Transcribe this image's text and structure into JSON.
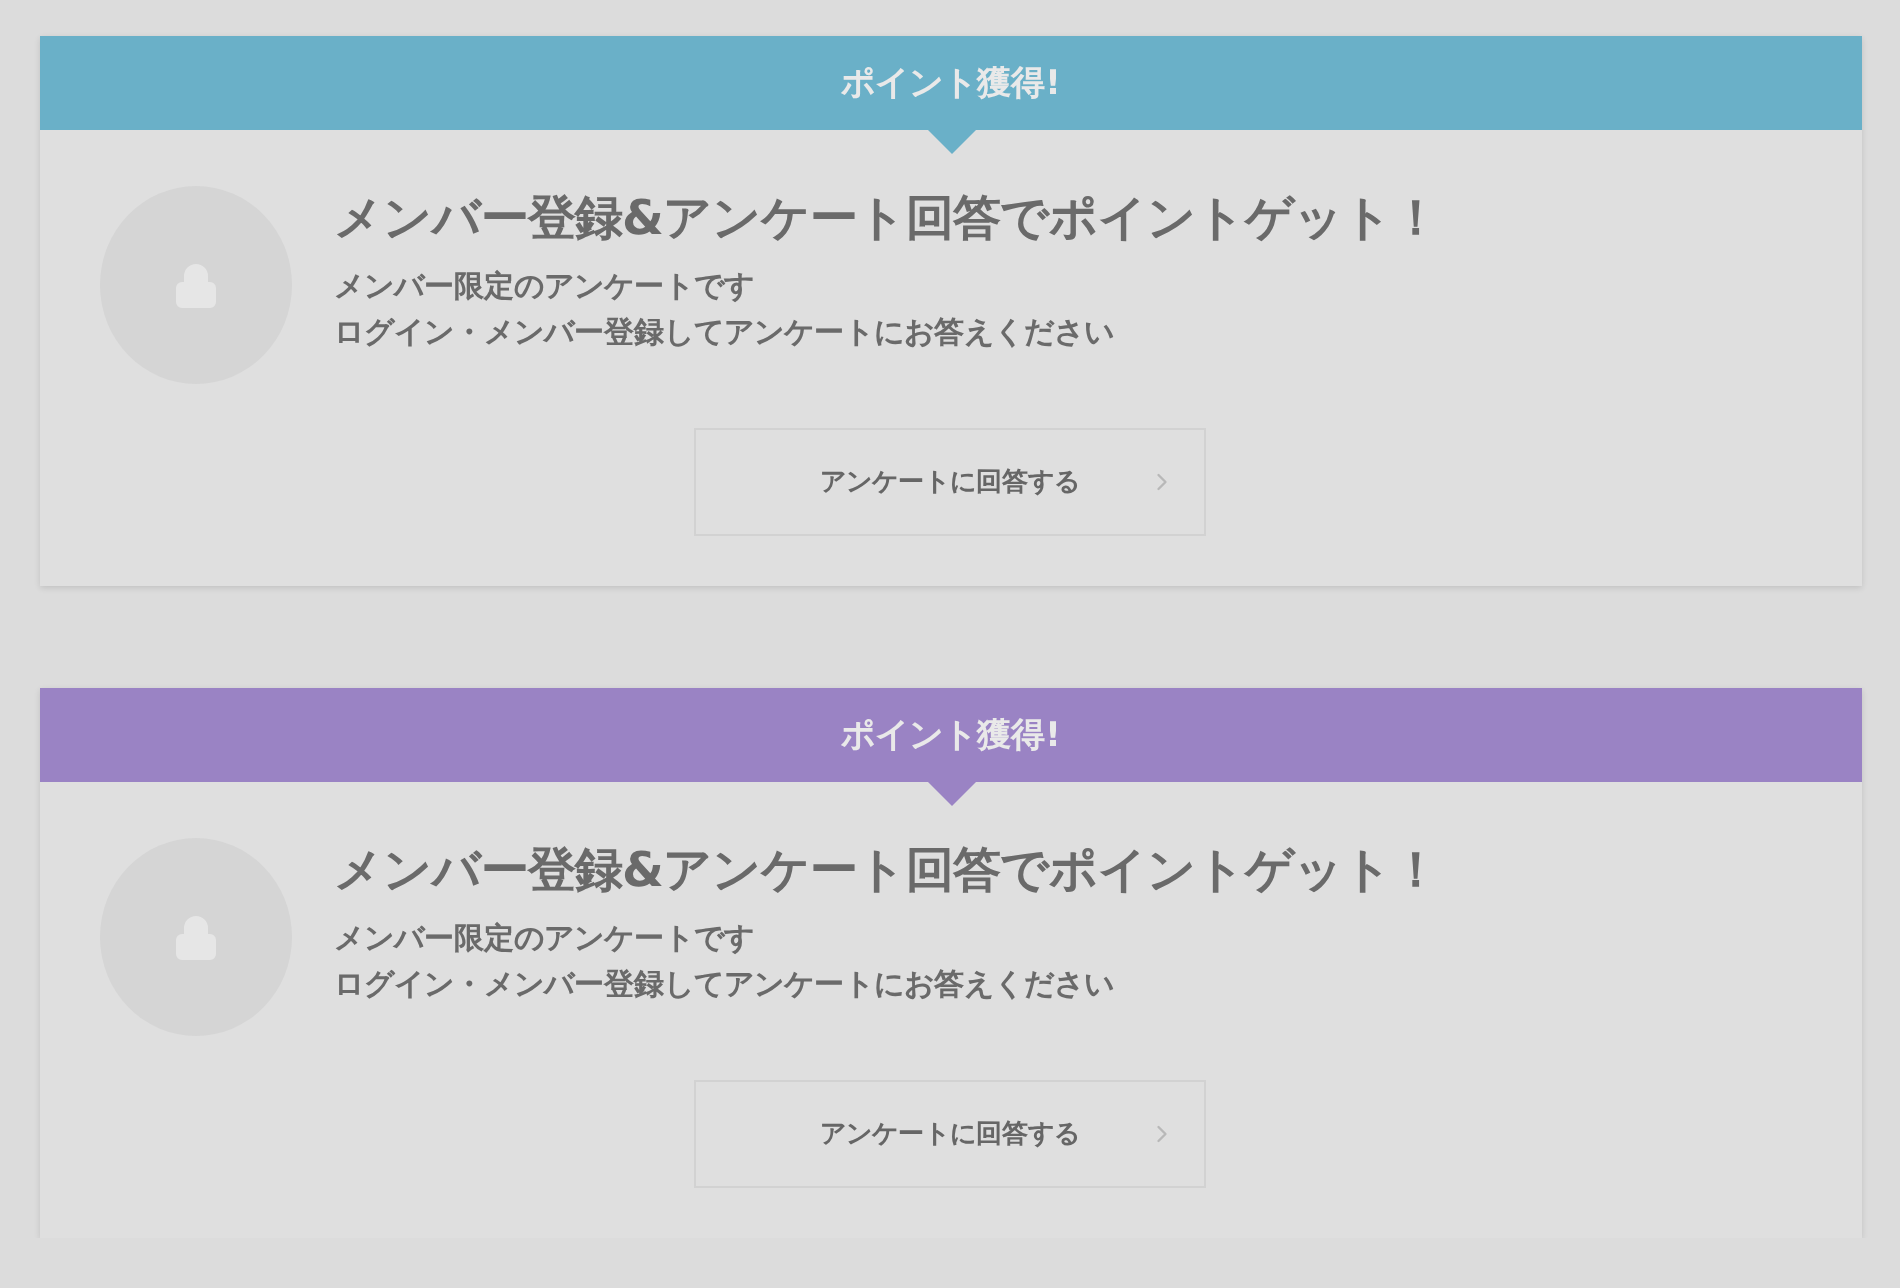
{
  "cards": [
    {
      "banner": "ポイント獲得!",
      "color": "#6ab0c8",
      "heading": "メンバー登録&アンケート回答でポイントゲット！",
      "lines": [
        "メンバー限定のアンケートです",
        "ログイン・メンバー登録してアンケートにお答えください"
      ],
      "button": "アンケートに回答する"
    },
    {
      "banner": "ポイント獲得!",
      "color": "#9a83c4",
      "heading": "メンバー登録&アンケート回答でポイントゲット！",
      "lines": [
        "メンバー限定のアンケートです",
        "ログイン・メンバー登録してアンケートにお答えください"
      ],
      "button": "アンケートに回答する"
    }
  ]
}
